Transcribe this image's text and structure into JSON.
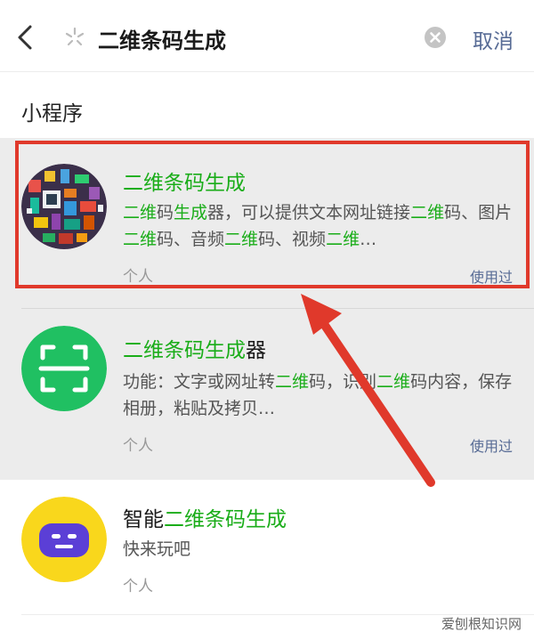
{
  "header": {
    "back_icon": "chevron-left-icon",
    "mini_program_icon": "mini-program-icon",
    "query": "二维条码生成",
    "clear_icon": "clear-circle-icon",
    "cancel_label": "取消"
  },
  "section": {
    "title": "小程序"
  },
  "results": [
    {
      "icon": "qr-collage-thumbnail",
      "title_parts": [
        "二维条码生成",
        ""
      ],
      "description_parts": [
        "二维",
        "码",
        "生成",
        "器，可以提供文本网址链接",
        "二维",
        "码、图片",
        "二维",
        "码、音频",
        "二维",
        "码、视频",
        "二维",
        "…"
      ],
      "owner": "个人",
      "used_label": "使用过"
    },
    {
      "icon": "scan-frame-icon",
      "title_parts": [
        "二维条码生成",
        "器"
      ],
      "description_parts": [
        "功能：文字或网址转",
        "二维",
        "码，识别",
        "二维",
        "码内容，保存相册，粘贴及拷贝…"
      ],
      "owner": "个人",
      "used_label": "使用过"
    },
    {
      "icon": "robot-face-icon",
      "title_parts": [
        "智能",
        "二维条码生成"
      ],
      "description": "快来玩吧",
      "owner": "个人"
    }
  ],
  "colors": {
    "highlight": "#1aad19",
    "link": "#576b95",
    "annotation": "#e0392b",
    "result_bg": "#ececec"
  },
  "watermark": "爱刨根知识网"
}
